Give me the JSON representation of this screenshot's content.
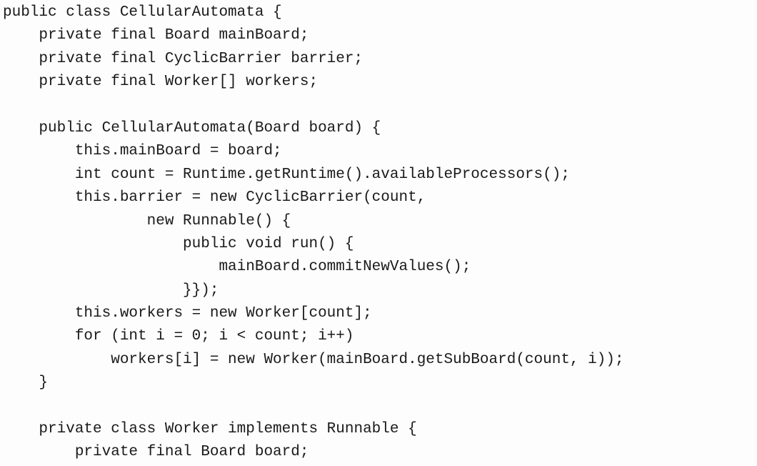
{
  "code": {
    "lines": [
      "public class CellularAutomata {",
      "    private final Board mainBoard;",
      "    private final CyclicBarrier barrier;",
      "    private final Worker[] workers;",
      "",
      "    public CellularAutomata(Board board) {",
      "        this.mainBoard = board;",
      "        int count = Runtime.getRuntime().availableProcessors();",
      "        this.barrier = new CyclicBarrier(count,",
      "                new Runnable() {",
      "                    public void run() {",
      "                        mainBoard.commitNewValues();",
      "                    }});",
      "        this.workers = new Worker[count];",
      "        for (int i = 0; i < count; i++)",
      "            workers[i] = new Worker(mainBoard.getSubBoard(count, i));",
      "    }",
      "",
      "    private class Worker implements Runnable {",
      "        private final Board board;"
    ]
  }
}
